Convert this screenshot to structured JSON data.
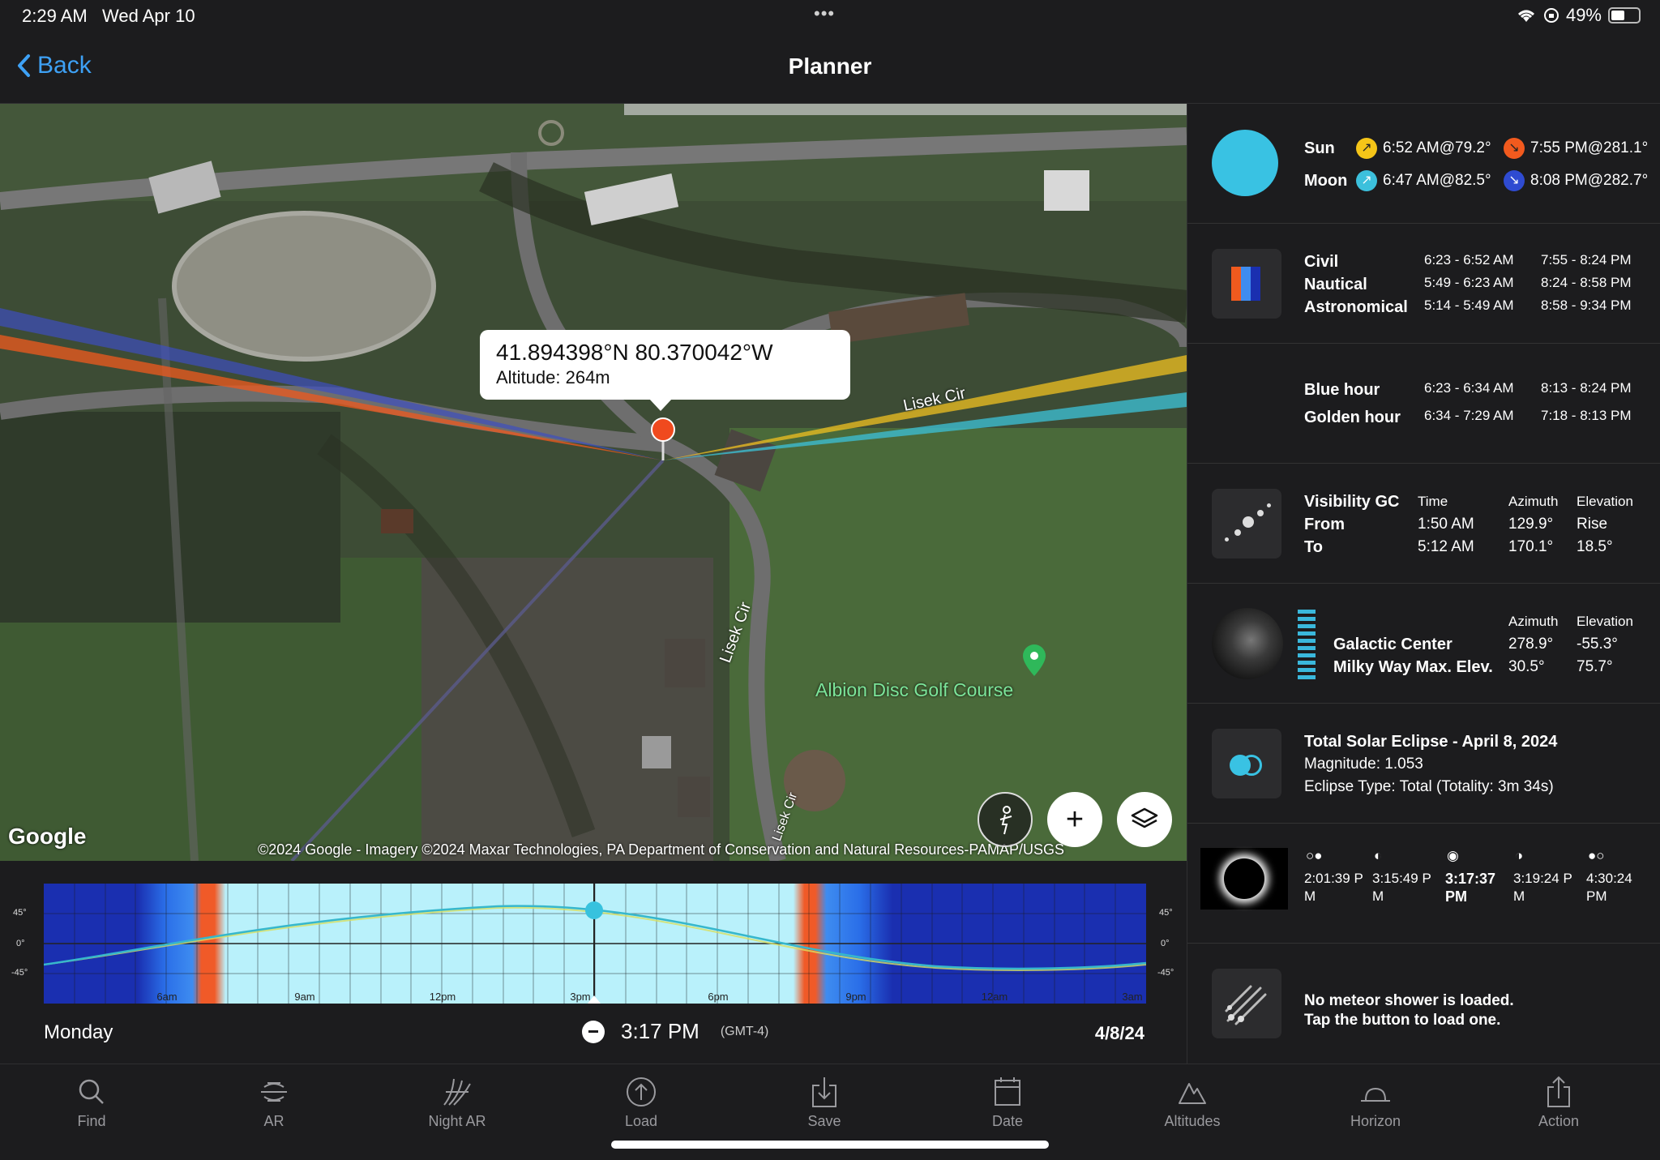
{
  "status": {
    "time": "2:29 AM",
    "date": "Wed Apr 10",
    "dots": "•••",
    "battery": "49%",
    "battery_level": 0.49
  },
  "nav": {
    "back_label": "Back",
    "title": "Planner"
  },
  "map": {
    "callout": {
      "coords": "41.894398°N 80.370042°W",
      "altitude": "Altitude: 264m"
    },
    "streets": [
      "Lisek Cir",
      "Lisek Cir",
      "Lisek Cir"
    ],
    "poi": "Albion Disc Golf Course",
    "logo": "Google",
    "attribution": "©2024 Google - Imagery ©2024 Maxar Technologies, PA Department of Conservation and Natural Resources-PAMAP/USGS",
    "buttons": {
      "add": "+"
    },
    "colors": {
      "sunrise": "#f0c020",
      "sunset": "#f05a1e",
      "moonrise": "#3cbccf",
      "moonset": "#3d4ebf"
    }
  },
  "timeline": {
    "day": "Monday",
    "time": "3:17 PM",
    "tz": "(GMT-4)",
    "date": "4/8/24",
    "y_ticks": [
      "45°",
      "0°",
      "-45°"
    ],
    "hour_labels": [
      "6am",
      "9am",
      "12pm",
      "3pm",
      "6pm",
      "9pm",
      "12am",
      "3am"
    ]
  },
  "sun_moon": {
    "sun_label": "Sun",
    "sun_rise": "6:52 AM@79.2°",
    "sun_set": "7:55 PM@281.1°",
    "moon_label": "Moon",
    "moon_rise": "6:47 AM@82.5°",
    "moon_set": "8:08 PM@282.7°",
    "colors": {
      "sun_rise": "#f5c518",
      "sun_set": "#f25a1e",
      "moon_rise": "#3cc0dc",
      "moon_set": "#2f4bd1",
      "moon_disc": "#39c2e3"
    }
  },
  "twilight": {
    "rows": [
      {
        "label": "Civil",
        "am": "6:23 - 6:52 AM",
        "pm": "7:55 - 8:24 PM"
      },
      {
        "label": "Nautical",
        "am": "5:49 - 6:23 AM",
        "pm": "8:24 - 8:58 PM"
      },
      {
        "label": "Astronomical",
        "am": "5:14 - 5:49 AM",
        "pm": "8:58 - 9:34 PM"
      }
    ]
  },
  "light": {
    "rows": [
      {
        "label": "Blue hour",
        "am": "6:23 - 6:34 AM",
        "pm": "8:13 - 8:24 PM"
      },
      {
        "label": "Golden hour",
        "am": "6:34 - 7:29 AM",
        "pm": "7:18 - 8:13 PM"
      }
    ]
  },
  "visibility": {
    "title": "Visibility GC",
    "h_time": "Time",
    "h_azimuth": "Azimuth",
    "h_elevation": "Elevation",
    "from_label": "From",
    "from_time": "1:50 AM",
    "from_az": "129.9°",
    "from_el": "Rise",
    "to_label": "To",
    "to_time": "5:12 AM",
    "to_az": "170.1°",
    "to_el": "18.5°"
  },
  "galactic": {
    "h_azimuth": "Azimuth",
    "h_elevation": "Elevation",
    "gc_label": "Galactic Center",
    "gc_az": "278.9°",
    "gc_el": "-55.3°",
    "mw_label": "Milky Way Max. Elev.",
    "mw_az": "30.5°",
    "mw_el": "75.7°"
  },
  "eclipse": {
    "title": "Total Solar Eclipse - April 8, 2024",
    "magnitude": "Magnitude: 1.053",
    "type": "Eclipse Type: Total (Totality: 3m 34s)",
    "contacts": [
      {
        "l1": "2:01:39 P",
        "l2": "M",
        "bold": false
      },
      {
        "l1": "3:15:49 P",
        "l2": "M",
        "bold": false
      },
      {
        "l1": "3:17:37",
        "l2": "PM",
        "bold": true
      },
      {
        "l1": "3:19:24 P",
        "l2": "M",
        "bold": false
      },
      {
        "l1": "4:30:24",
        "l2": "PM",
        "bold": false
      }
    ]
  },
  "meteor": {
    "line1": "No meteor shower is loaded.",
    "line2": "Tap the button to load one."
  },
  "tabs": [
    {
      "label": "Find",
      "icon": "search-icon"
    },
    {
      "label": "AR",
      "icon": "ar-icon"
    },
    {
      "label": "Night AR",
      "icon": "night-ar-icon"
    },
    {
      "label": "Load",
      "icon": "load-icon"
    },
    {
      "label": "Save",
      "icon": "save-icon"
    },
    {
      "label": "Date",
      "icon": "calendar-icon"
    },
    {
      "label": "Altitudes",
      "icon": "mountain-icon"
    },
    {
      "label": "Horizon",
      "icon": "horizon-icon"
    },
    {
      "label": "Action",
      "icon": "share-icon"
    }
  ]
}
